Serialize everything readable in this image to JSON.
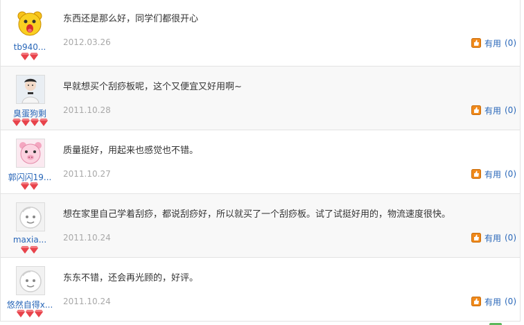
{
  "reviews": [
    {
      "user": "tb940...",
      "avatar": "yellow-bear-avatar",
      "rank": 2,
      "content": "东西还是那么好，同学们都很开心",
      "date": "2012.03.26",
      "useful_label": "有用",
      "useful_count": "(0)"
    },
    {
      "user": "臭蛋狗剩",
      "avatar": "child-photo-avatar",
      "rank": 4,
      "content": "早就想买个刮痧板呢，这个又便宜又好用啊~",
      "date": "2011.10.28",
      "useful_label": "有用",
      "useful_count": "(0)"
    },
    {
      "user": "郭闪闪19...",
      "avatar": "pink-pig-avatar",
      "rank": 2,
      "content": "质量挺好，用起来也感觉也不错。",
      "date": "2011.10.27",
      "useful_label": "有用",
      "useful_count": "(0)"
    },
    {
      "user": "maxia...",
      "avatar": "default-face-avatar",
      "rank": 2,
      "content": "想在家里自己学着刮痧，都说刮痧好，所以就买了一个刮痧板。试了试挺好用的，物流速度很快。",
      "date": "2011.10.24",
      "useful_label": "有用",
      "useful_count": "(0)"
    },
    {
      "user": "悠然自得x...",
      "avatar": "default-face-avatar",
      "rank": 3,
      "content": "东东不错，还会再光顾的，好评。",
      "date": "2011.10.24",
      "useful_label": "有用",
      "useful_count": "(0)"
    }
  ],
  "colors": {
    "link": "#2866b8",
    "date": "#a8a8a8",
    "gem": "#e8434b",
    "useful_icon": "#f08a1c",
    "alt_row": "#f8f8f8",
    "scroll_stub": "#5cb85c"
  }
}
